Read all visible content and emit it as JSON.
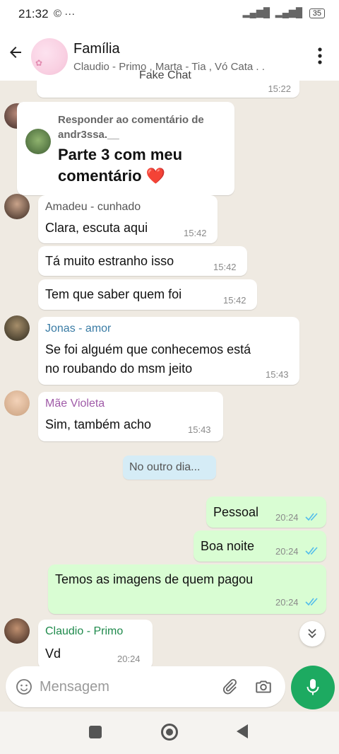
{
  "status_bar": {
    "time": "21:32",
    "icons": "© ···",
    "battery": "35"
  },
  "header": {
    "title": "Família",
    "subtitle": "Claudio - Primo , Marta - Tia , Vó Cata . ."
  },
  "watermark": "Fake Chat",
  "messages": {
    "top_time": "15:22",
    "reply": {
      "label_line1": "Responder ao comentário de",
      "label_line2": "andr3ssa.__",
      "text_line1": "Parte 3 com meu",
      "text_line2": "comentário ❤️"
    },
    "amadeu": {
      "sender": "Amadeu - cunhado",
      "m1_text": "Clara, escuta aqui",
      "m1_time": "15:42",
      "m2_text": "Tá muito estranho isso",
      "m2_time": "15:42",
      "m3_text": "Tem que saber quem foi",
      "m3_time": "15:42"
    },
    "jonas": {
      "sender": "Jonas - amor",
      "line1": "Se foi alguém que conhecemos está",
      "line2": "no roubando do msm jeito",
      "time": "15:43"
    },
    "mae": {
      "sender": "Mãe Violeta",
      "text": "Sim, também acho",
      "time": "15:43"
    },
    "date_divider": "No outro dia...",
    "out1": {
      "text": "Pessoal",
      "time": "20:24"
    },
    "out2": {
      "text": "Boa noite",
      "time": "20:24"
    },
    "out3": {
      "text": "Temos as imagens de quem pagou",
      "time": "20:24"
    },
    "claudio": {
      "sender": "Claudio - Primo",
      "text": "Vd",
      "time": "20:24"
    }
  },
  "input": {
    "placeholder": "Mensagem"
  },
  "colors": {
    "outgoing_bubble": "#d9fdd3",
    "incoming_bubble": "#ffffff",
    "mic_button": "#1daa61",
    "read_ticks": "#53bdeb",
    "sender_amadeu": "#555555",
    "sender_jonas": "#3a7ca5",
    "sender_mae": "#a05ba8",
    "sender_claudio": "#1f8a4c"
  }
}
